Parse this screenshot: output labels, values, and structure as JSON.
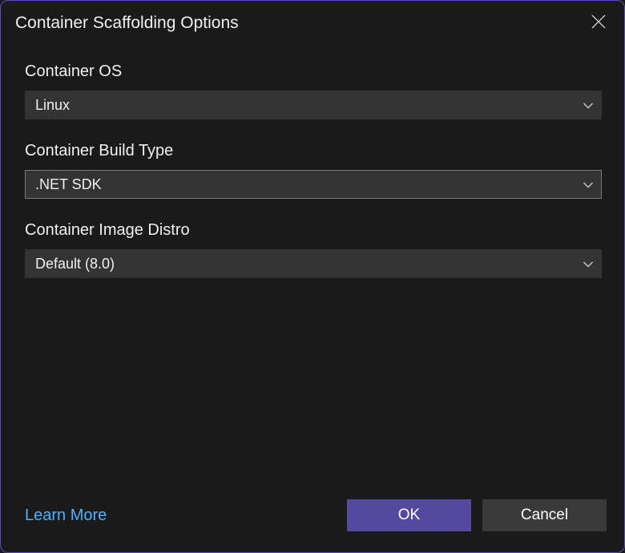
{
  "dialog": {
    "title": "Container Scaffolding Options"
  },
  "fields": {
    "containerOS": {
      "label": "Container OS",
      "value": "Linux"
    },
    "containerBuildType": {
      "label": "Container Build Type",
      "value": ".NET SDK"
    },
    "containerImageDistro": {
      "label": "Container Image Distro",
      "value": "Default (8.0)"
    }
  },
  "footer": {
    "learnMore": "Learn More",
    "ok": "OK",
    "cancel": "Cancel"
  }
}
